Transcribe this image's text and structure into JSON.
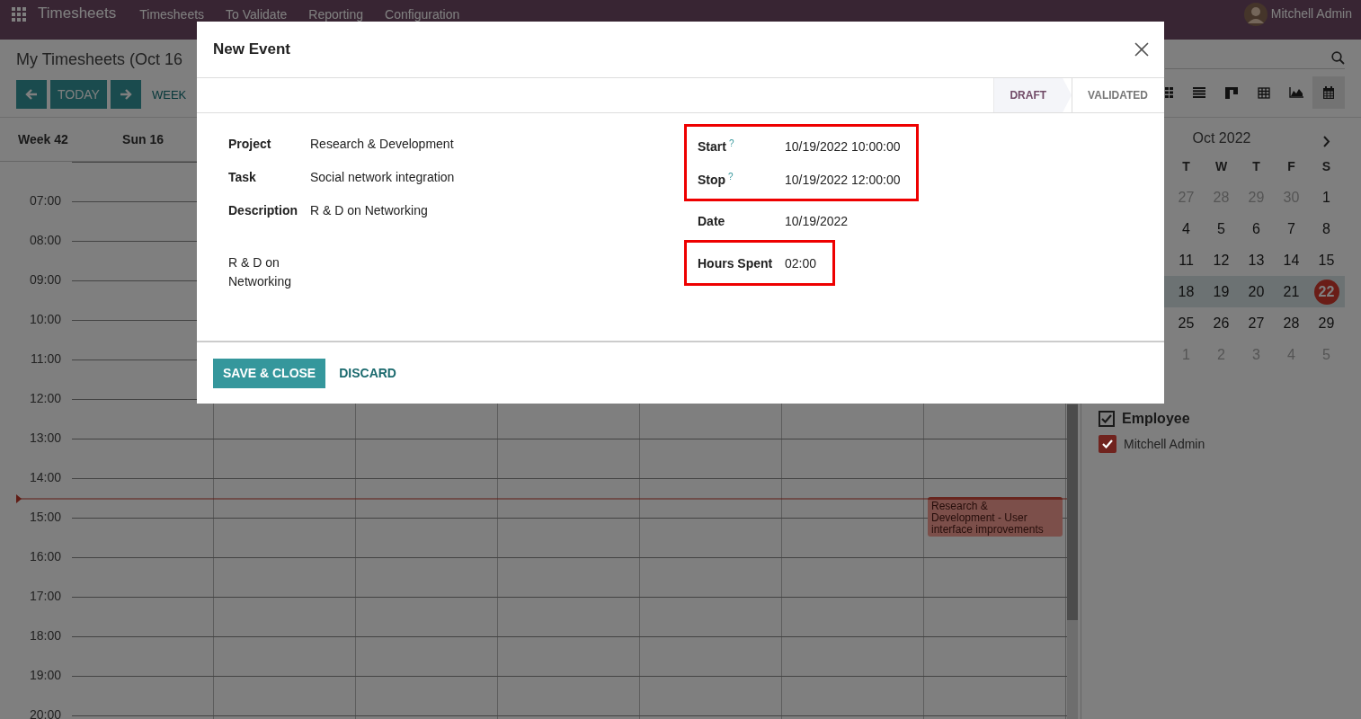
{
  "navbar": {
    "app_name": "Timesheets",
    "menu": [
      "Timesheets",
      "To Validate",
      "Reporting",
      "Configuration"
    ],
    "user": "Mitchell Admin"
  },
  "control_panel": {
    "title": "My Timesheets (Oct 16",
    "today_button": "TODAY",
    "scale_button": "WEEK",
    "views": [
      {
        "kind": "kanban",
        "selected": false
      },
      {
        "kind": "list",
        "selected": false
      },
      {
        "kind": "blocks",
        "selected": false
      },
      {
        "kind": "pivot",
        "selected": false
      },
      {
        "kind": "graph",
        "selected": false
      },
      {
        "kind": "calendar",
        "selected": true
      }
    ]
  },
  "calendar": {
    "week_label": "Week 42",
    "days": [
      "Sun 16"
    ],
    "hours": [
      "07:00",
      "08:00",
      "09:00",
      "10:00",
      "11:00",
      "12:00",
      "13:00",
      "14:00",
      "15:00",
      "16:00",
      "17:00",
      "18:00",
      "19:00",
      "20:00"
    ],
    "events": [
      {
        "title": "Research & Development - User interface improvements"
      }
    ]
  },
  "sidebar": {
    "month": "Oct 2022",
    "weekdays": [
      "T",
      "W",
      "T",
      "F",
      "S"
    ],
    "weeks": [
      {
        "selected": false,
        "days": [
          {
            "label": "27",
            "muted": true,
            "today": false
          },
          {
            "label": "28",
            "muted": true,
            "today": false
          },
          {
            "label": "29",
            "muted": true,
            "today": false
          },
          {
            "label": "30",
            "muted": true,
            "today": false
          },
          {
            "label": "1",
            "muted": false,
            "today": false
          }
        ]
      },
      {
        "selected": false,
        "days": [
          {
            "label": "4",
            "muted": false,
            "today": false
          },
          {
            "label": "5",
            "muted": false,
            "today": false
          },
          {
            "label": "6",
            "muted": false,
            "today": false
          },
          {
            "label": "7",
            "muted": false,
            "today": false
          },
          {
            "label": "8",
            "muted": false,
            "today": false
          }
        ]
      },
      {
        "selected": false,
        "days": [
          {
            "label": "11",
            "muted": false,
            "today": false
          },
          {
            "label": "12",
            "muted": false,
            "today": false
          },
          {
            "label": "13",
            "muted": false,
            "today": false
          },
          {
            "label": "14",
            "muted": false,
            "today": false
          },
          {
            "label": "15",
            "muted": false,
            "today": false
          }
        ]
      },
      {
        "selected": true,
        "days": [
          {
            "label": "18",
            "muted": false,
            "today": false
          },
          {
            "label": "19",
            "muted": false,
            "today": false
          },
          {
            "label": "20",
            "muted": false,
            "today": false
          },
          {
            "label": "21",
            "muted": false,
            "today": false
          },
          {
            "label": "22",
            "muted": false,
            "today": true
          }
        ]
      },
      {
        "selected": false,
        "days": [
          {
            "label": "25",
            "muted": false,
            "today": false
          },
          {
            "label": "26",
            "muted": false,
            "today": false
          },
          {
            "label": "27",
            "muted": false,
            "today": false
          },
          {
            "label": "28",
            "muted": false,
            "today": false
          },
          {
            "label": "29",
            "muted": false,
            "today": false
          }
        ]
      },
      {
        "selected": false,
        "days": [
          {
            "label": "1",
            "muted": true,
            "today": false
          },
          {
            "label": "2",
            "muted": true,
            "today": false
          },
          {
            "label": "3",
            "muted": true,
            "today": false
          },
          {
            "label": "4",
            "muted": true,
            "today": false
          },
          {
            "label": "5",
            "muted": true,
            "today": false
          }
        ]
      }
    ],
    "filter": {
      "title": "Employee",
      "checked": true,
      "items": [
        {
          "name": "Mitchell Admin",
          "checked": true,
          "color": "#70231e"
        }
      ]
    }
  },
  "dialog": {
    "title": "New Event",
    "stages": [
      {
        "label": "DRAFT",
        "selected": true
      },
      {
        "label": "VALIDATED",
        "selected": false
      }
    ],
    "left_fields": [
      {
        "label": "Project",
        "value": "Research & Development"
      },
      {
        "label": "Task",
        "value": "Social network integration"
      },
      {
        "label": "Description",
        "value": "R & D on Networking"
      }
    ],
    "note": "R & D on Networking",
    "right_groups": [
      {
        "highlighted": true,
        "fields": [
          {
            "label": "Start",
            "help": "?",
            "value": "10/19/2022 10:00:00"
          },
          {
            "label": "Stop",
            "help": "?",
            "value": "10/19/2022 12:00:00"
          }
        ]
      },
      {
        "highlighted": false,
        "fields": [
          {
            "label": "Date",
            "value": "10/19/2022"
          }
        ]
      },
      {
        "highlighted": true,
        "fields": [
          {
            "label": "Hours Spent",
            "value": "02:00"
          }
        ]
      }
    ],
    "buttons": [
      {
        "label": "SAVE & CLOSE",
        "kind": "primary"
      },
      {
        "label": "DISCARD",
        "kind": "link"
      }
    ]
  }
}
